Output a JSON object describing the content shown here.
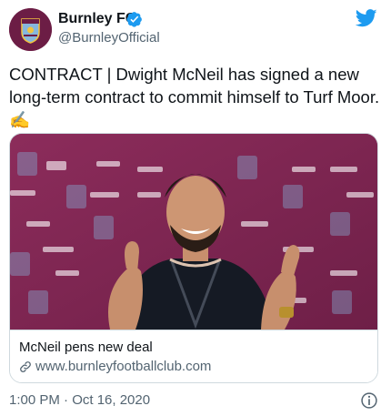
{
  "account": {
    "display_name": "Burnley FC",
    "handle": "@BurnleyOfficial",
    "verified_icon": "verified-badge-icon",
    "avatar_icon": "burnley-crest"
  },
  "tweet": {
    "text": "CONTRACT | Dwight McNeil has signed a new long-term contract to commit himself to Turf Moor.✍️",
    "timestamp": "1:00 PM · Oct 16, 2020"
  },
  "card": {
    "title": "McNeil pens new deal",
    "url": "www.burnleyfootballclub.com",
    "link_icon": "link-icon"
  },
  "colors": {
    "twitter_blue": "#1d9bf0",
    "claret": "#7c2550",
    "text_primary": "#0f1419",
    "text_secondary": "#536471"
  }
}
